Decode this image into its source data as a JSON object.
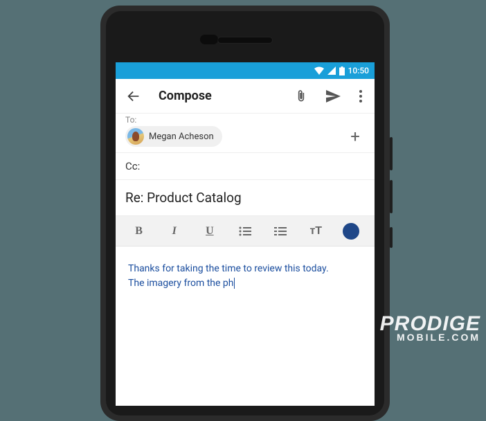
{
  "status": {
    "time": "10:50"
  },
  "appbar": {
    "title": "Compose"
  },
  "to": {
    "label": "To:",
    "chip_name": "Megan Acheson"
  },
  "cc": {
    "label": "Cc:"
  },
  "subject": {
    "text": "Re: Product Catalog"
  },
  "format": {
    "bold": "B",
    "italic": "I",
    "underline": "U",
    "textsize": "ᴛT"
  },
  "body": {
    "line1": "Thanks for taking the time to review this today.",
    "line2": "The imagery from the ph"
  },
  "watermark": {
    "main": "PRODIGE",
    "sub": "MOBILE.COM"
  }
}
